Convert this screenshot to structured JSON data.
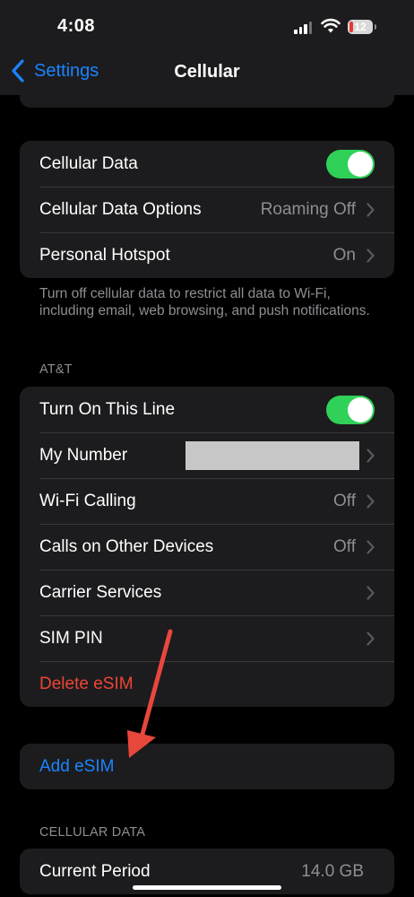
{
  "status_bar": {
    "time": "4:08",
    "battery_level": "12"
  },
  "nav": {
    "back_label": "Settings",
    "title": "Cellular"
  },
  "group1": {
    "cellular_data": {
      "label": "Cellular Data",
      "toggle_on": true
    },
    "cellular_data_options": {
      "label": "Cellular Data Options",
      "value": "Roaming Off"
    },
    "personal_hotspot": {
      "label": "Personal Hotspot",
      "value": "On"
    }
  },
  "group1_footer": "Turn off cellular data to restrict all data to Wi-Fi, including email, web browsing, and push notifications.",
  "att_header": "AT&T",
  "att": {
    "turn_on_line": {
      "label": "Turn On This Line",
      "toggle_on": true
    },
    "my_number": {
      "label": "My Number"
    },
    "wifi_calling": {
      "label": "Wi-Fi Calling",
      "value": "Off"
    },
    "calls_other_devices": {
      "label": "Calls on Other Devices",
      "value": "Off"
    },
    "carrier_services": {
      "label": "Carrier Services"
    },
    "sim_pin": {
      "label": "SIM PIN"
    },
    "delete_esim": {
      "label": "Delete eSIM"
    }
  },
  "add_esim": {
    "label": "Add eSIM"
  },
  "cellular_data_header": "CELLULAR DATA",
  "usage": {
    "current_period": {
      "label": "Current Period",
      "value": "14.0 GB"
    }
  },
  "colors": {
    "accent_blue": "#1a84ff",
    "destructive_red": "#ec4536",
    "toggle_green": "#30d158",
    "annotation_arrow": "#e8473c"
  }
}
